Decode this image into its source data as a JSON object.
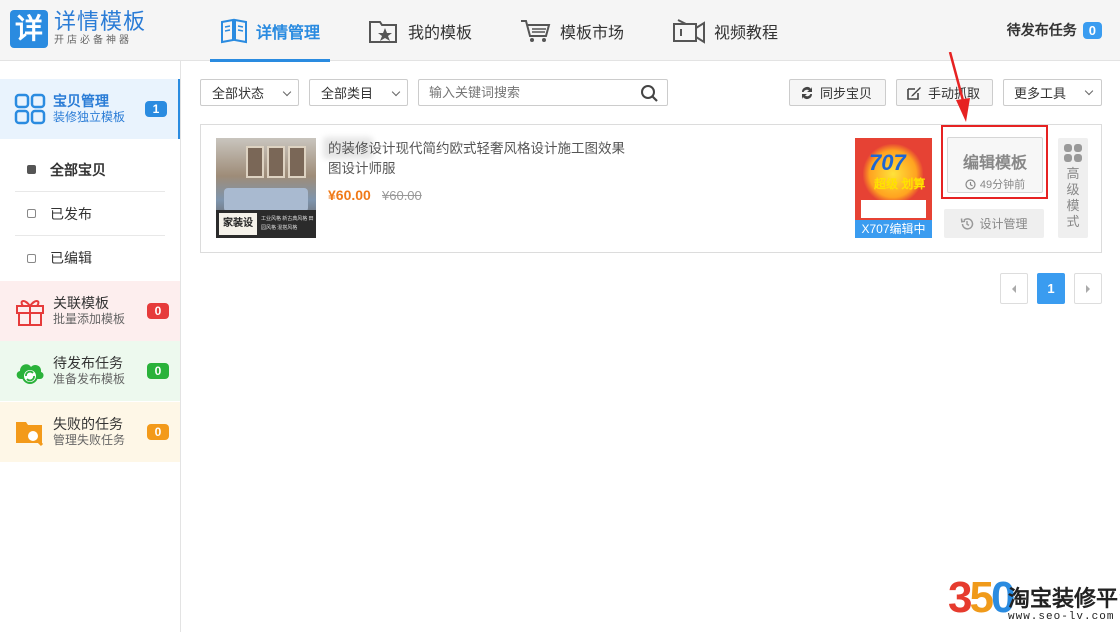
{
  "app": {
    "logo_char": "详",
    "title": "详情模板",
    "subtitle": "开店必备神器"
  },
  "nav": [
    {
      "label": "详情管理",
      "icon": "book-icon",
      "active": true
    },
    {
      "label": "我的模板",
      "icon": "star-folder-icon"
    },
    {
      "label": "模板市场",
      "icon": "cart-icon"
    },
    {
      "label": "视频教程",
      "icon": "video-icon"
    }
  ],
  "pending": {
    "label": "待发布任务",
    "count": "0"
  },
  "sidebar": {
    "main": {
      "title": "宝贝管理",
      "subtitle": "装修独立模板",
      "count": "1",
      "count_color": "#2a8be0"
    },
    "sub_items": [
      {
        "label": "全部宝贝"
      },
      {
        "label": "已发布"
      },
      {
        "label": "已编辑"
      }
    ],
    "link": {
      "title": "关联模板",
      "subtitle": "批量添加模板",
      "count": "0",
      "count_color": "#e63b3b"
    },
    "wait": {
      "title": "待发布任务",
      "subtitle": "准备发布模板",
      "count": "0",
      "count_color": "#2ab23a"
    },
    "fail": {
      "title": "失败的任务",
      "subtitle": "管理失败任务",
      "count": "0",
      "count_color": "#f39a1a"
    }
  },
  "toolbar": {
    "status_filter": "全部状态",
    "category_filter": "全部类目",
    "search_placeholder": "输入关键词搜索",
    "sync_label": "同步宝贝",
    "manual_label": "手动抓取",
    "more_label": "更多工具"
  },
  "product": {
    "title": "的装修设计现代简约欧式轻奢风格设计施工图效果图设计师服",
    "price": "¥60.00",
    "original_price": "¥60.00",
    "thumb_label": "家装设计",
    "thumb_tags": "工业风格 新古典风格 田园风格 混搭风格",
    "template_status": "X707编辑中",
    "template_big": "707",
    "template_mid": "超级 划算",
    "edit_label": "编辑模板",
    "edit_time": "49分钟前",
    "design_label": "设计管理",
    "advanced_label": "高级模式"
  },
  "pagination": {
    "current": "1"
  },
  "watermark": {
    "number_a": "3",
    "number_b": "5",
    "number_c": "0",
    "name": "淘宝装修平台",
    "url": "www.seo-lv.com"
  }
}
